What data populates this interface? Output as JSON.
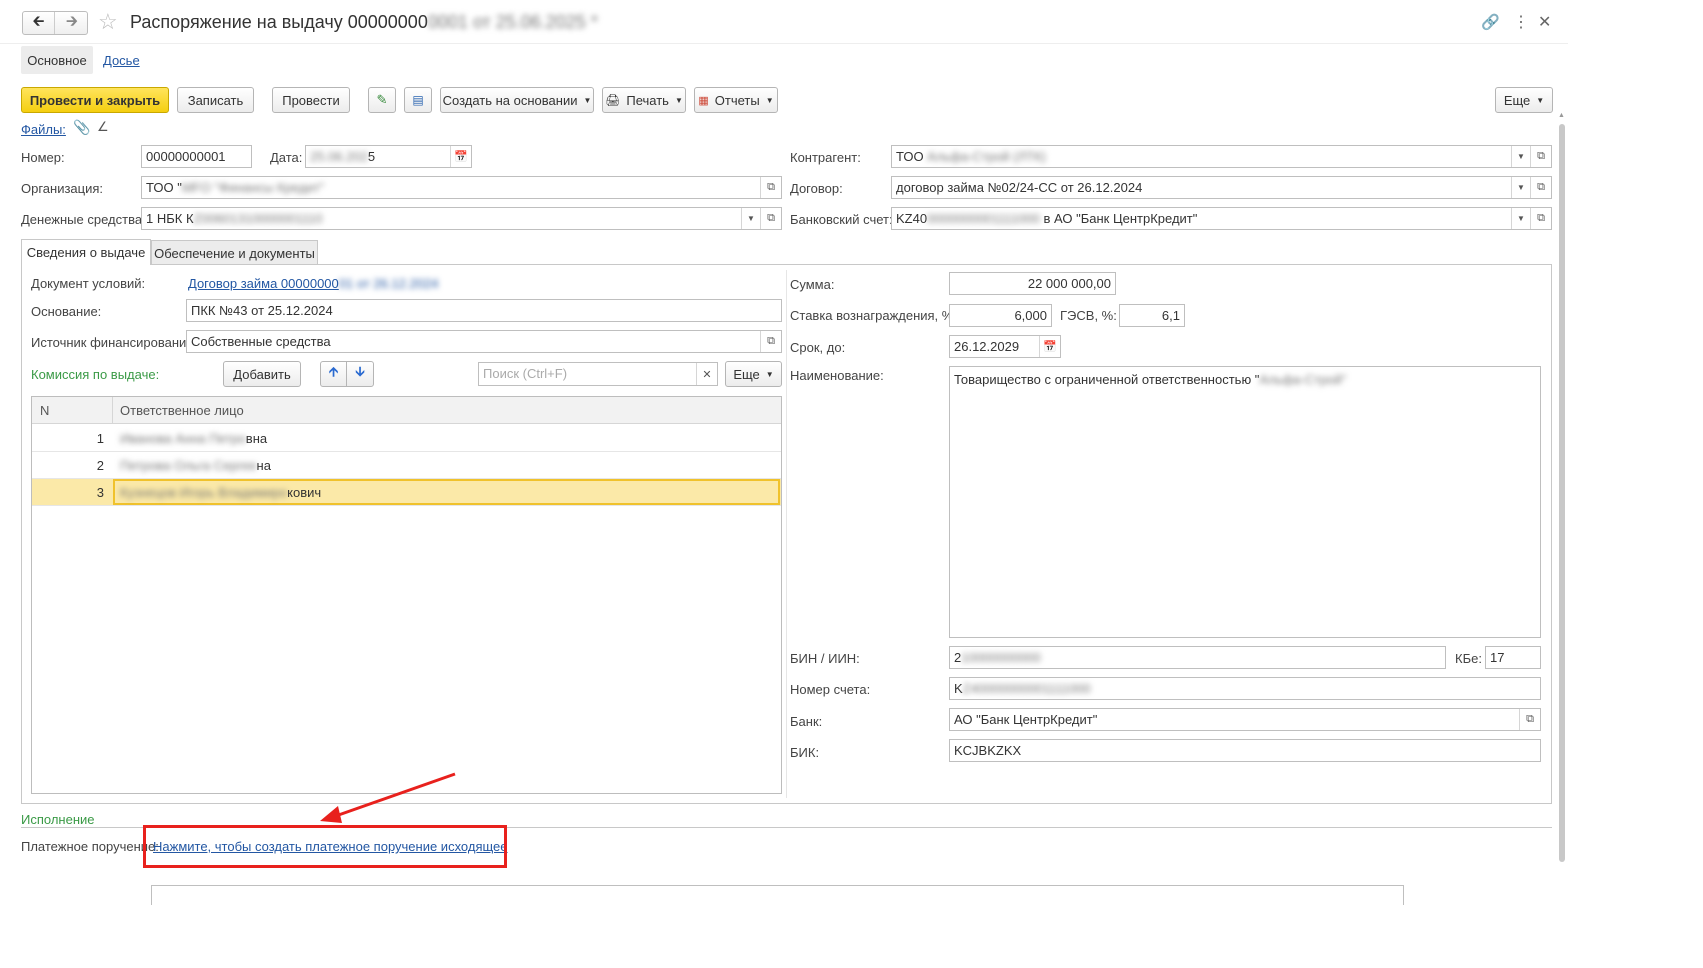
{
  "window": {
    "title_visible": "Распоряжение на выдачу 00000000",
    "title_masked": "0001 от 25.06.2025 *"
  },
  "nav_tabs": {
    "main": "Основное",
    "dossier": "Досье"
  },
  "toolbar": {
    "post_close": "Провести и закрыть",
    "save": "Записать",
    "post": "Провести",
    "create_based": "Создать на основании",
    "print": "Печать",
    "reports": "Отчеты",
    "more": "Еще"
  },
  "files": {
    "label": "Файлы:"
  },
  "header": {
    "number_label": "Номер:",
    "number_value": "00000000001",
    "date_label": "Дата:",
    "date_masked": "25.06.202",
    "date_visible": "5",
    "org_label": "Организация:",
    "org_visible": "ТОО \"",
    "org_masked": "MFO \"Финансы Кредит\"",
    "funds_label": "Денежные средства:",
    "funds_visible": "1 НБК К",
    "funds_masked": "Z00601310000001110",
    "counterparty_label": "Контрагент:",
    "counterparty_visible": "ТОО",
    "counterparty_masked": "Альфа-Строй (ЛТК)",
    "contract_label": "Договор:",
    "contract_value": "договор займа №02/24-СС от 26.12.2024",
    "bank_account_label": "Банковский счет:",
    "bank_account_visible_start": "KZ40",
    "bank_account_masked": "0000000001111000",
    "bank_account_visible_end": "в АО \"Банк ЦентрКредит\""
  },
  "tabs": {
    "issue_info": "Сведения о выдаче",
    "security_docs": "Обеспечение и документы"
  },
  "issue": {
    "doc_terms_label": "Документ условий:",
    "doc_terms_visible": "Договор займа 00000000",
    "doc_terms_masked": "01 от 26.12.2024",
    "basis_label": "Основание:",
    "basis_value": "ПКК №43 от 25.12.2024",
    "finance_source_label": "Источник финансирования:",
    "finance_source_value": "Собственные средства",
    "commission_label": "Комиссия по выдаче:",
    "add_button": "Добавить",
    "search_placeholder": "Поиск (Ctrl+F)",
    "more": "Еще"
  },
  "table": {
    "col_n": "N",
    "col_person": "Ответственное лицо",
    "rows": [
      {
        "n": "1",
        "masked": "Иванова Анна Петро",
        "visible": "вна"
      },
      {
        "n": "2",
        "masked": "Петрова Ольга Сергее",
        "visible": "на"
      },
      {
        "n": "3",
        "masked": "Кузнецов Игорь Владимиро",
        "visible": "кович"
      }
    ]
  },
  "right_panel": {
    "sum_label": "Сумма:",
    "sum_value": "22 000 000,00",
    "rate_label": "Ставка вознаграждения, %:",
    "rate_value": "6,000",
    "gesv_label": "ГЭСВ, %:",
    "gesv_value": "6,1",
    "term_label": "Срок, до:",
    "term_value": "26.12.2029",
    "name_label": "Наименование:",
    "name_visible": "Товарищество с ограниченной ответственностью \"",
    "name_masked": "Альфа-Строй\"",
    "bin_label": "БИН / ИИН:",
    "bin_visible": "2",
    "bin_masked": "10000000000",
    "kbe_label": "КБе:",
    "kbe_value": "17",
    "account_label": "Номер счета:",
    "account_visible": "K",
    "account_masked": "Z40000000001111000",
    "bank_label": "Банк:",
    "bank_value": "АО \"Банк ЦентрКредит\"",
    "bik_label": "БИК:",
    "bik_value": "KCJBKZKX"
  },
  "execution": {
    "section_label": "Исполнение",
    "payment_label": "Платежное поручение:",
    "payment_link": "Нажмите, чтобы создать платежное поручение исходящее"
  },
  "colors": {
    "primary_button": "#f5cf10",
    "link": "#2357a3",
    "section_green": "#3a9a46",
    "highlight_row": "#fbe9a8",
    "annotation": "#e8211d"
  }
}
